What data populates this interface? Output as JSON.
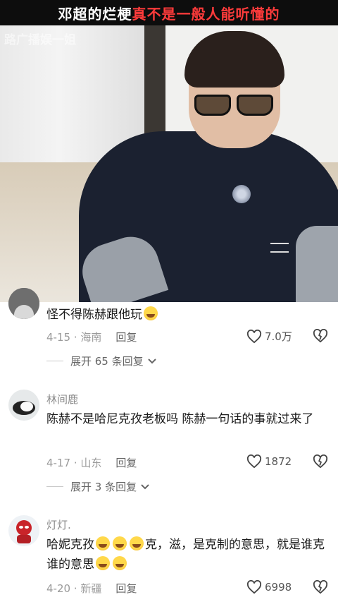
{
  "video": {
    "title_white_1": "邓超的烂梗",
    "title_red": "真不是一般人能听懂的",
    "watermark": "路广播娱一姐"
  },
  "comments": [
    {
      "username": "",
      "text": "怪不得陈赫跟他玩",
      "date": "4-15",
      "location": "海南",
      "reply_label": "回复",
      "likes": "7.0万",
      "expand_label": "展开 65 条回复"
    },
    {
      "username": "林间鹿",
      "text": "陈赫不是哈尼克孜老板吗 陈赫一句话的事就过来了",
      "date": "4-17",
      "location": "山东",
      "reply_label": "回复",
      "likes": "1872",
      "expand_label": "展开 3 条回复"
    },
    {
      "username": "灯灯.",
      "text_part1": "哈妮克孜",
      "text_part2": "克，滋，是克制的意思，就是谁克谁的意思",
      "date": "4-20",
      "location": "新疆",
      "reply_label": "回复",
      "likes": "6998"
    }
  ],
  "icons": {
    "like": "heart-icon",
    "dislike": "broken-heart-icon",
    "expand": "chevron-down-icon",
    "emoji": "laughing-crying-emoji"
  },
  "colors": {
    "title_red": "#ff3b3b",
    "meta_gray": "#9a9a9a"
  }
}
